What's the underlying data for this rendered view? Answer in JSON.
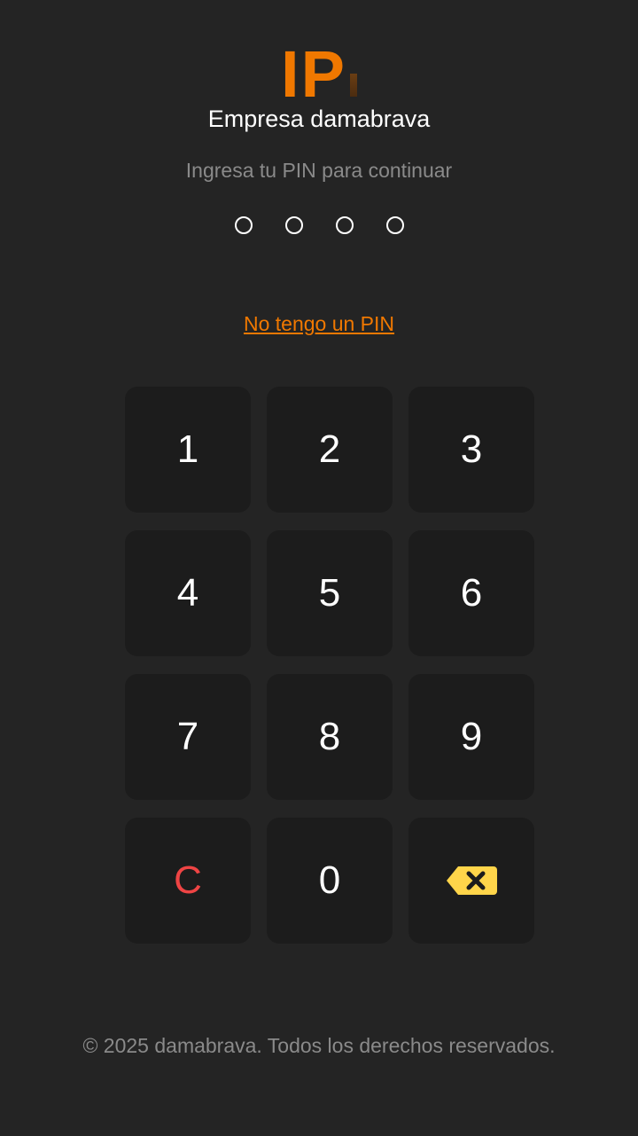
{
  "brand": {
    "logo_text": "IP",
    "accent_color": "#f07800",
    "company_name": "Empresa damabrava"
  },
  "prompt": {
    "subtitle": "Ingresa tu PIN para continuar",
    "pin_length": 4,
    "pin_filled": 0,
    "no_pin_link": "No tengo un PIN"
  },
  "keypad": {
    "keys": [
      "1",
      "2",
      "3",
      "4",
      "5",
      "6",
      "7",
      "8",
      "9",
      "C",
      "0"
    ],
    "clear_color": "#ef4444",
    "backspace_icon": "backspace-icon",
    "backspace_color": "#ffd54a"
  },
  "footer": {
    "copyright": "© 2025 damabrava. Todos los derechos reservados."
  }
}
